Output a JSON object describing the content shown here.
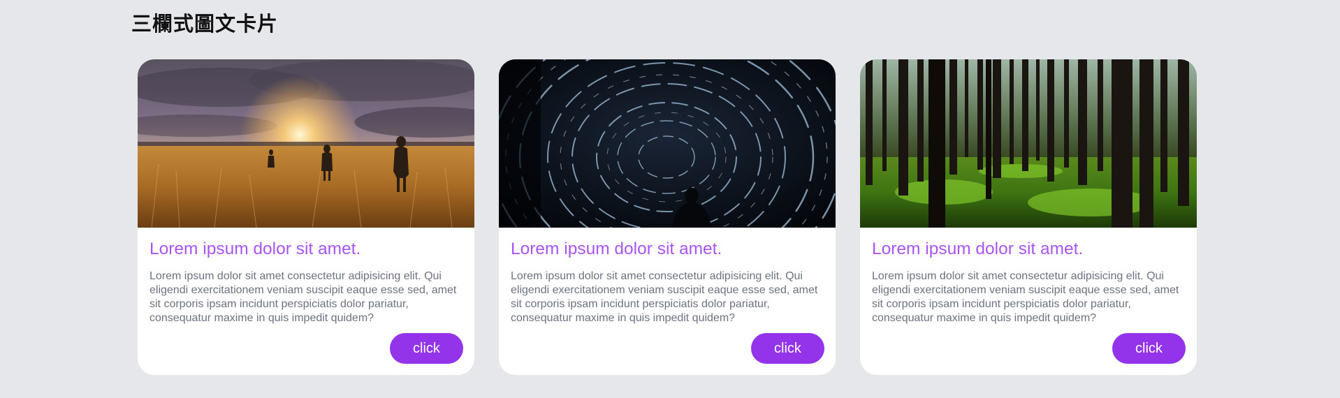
{
  "page": {
    "title": "三欄式圖文卡片"
  },
  "colors": {
    "background": "#e5e7eb",
    "card_background": "#ffffff",
    "title_accent": "#a855f7",
    "body_text": "#6b7280",
    "button": "#9333ea"
  },
  "cards": [
    {
      "image_name": "sunset-field-image",
      "title": "Lorem ipsum dolor sit amet.",
      "text": "Lorem ipsum dolor sit amet consectetur adipisicing elit. Qui eligendi exercitationem veniam suscipit eaque esse sed, amet sit corporis ipsam incidunt perspiciatis dolor pariatur, consequatur maxime in quis impedit quidem?",
      "button": "click"
    },
    {
      "image_name": "star-trails-image",
      "title": "Lorem ipsum dolor sit amet.",
      "text": "Lorem ipsum dolor sit amet consectetur adipisicing elit. Qui eligendi exercitationem veniam suscipit eaque esse sed, amet sit corporis ipsam incidunt perspiciatis dolor pariatur, consequatur maxime in quis impedit quidem?",
      "button": "click"
    },
    {
      "image_name": "forest-image",
      "title": "Lorem ipsum dolor sit amet.",
      "text": "Lorem ipsum dolor sit amet consectetur adipisicing elit. Qui eligendi exercitationem veniam suscipit eaque esse sed, amet sit corporis ipsam incidunt perspiciatis dolor pariatur, consequatur maxime in quis impedit quidem?",
      "button": "click"
    }
  ]
}
